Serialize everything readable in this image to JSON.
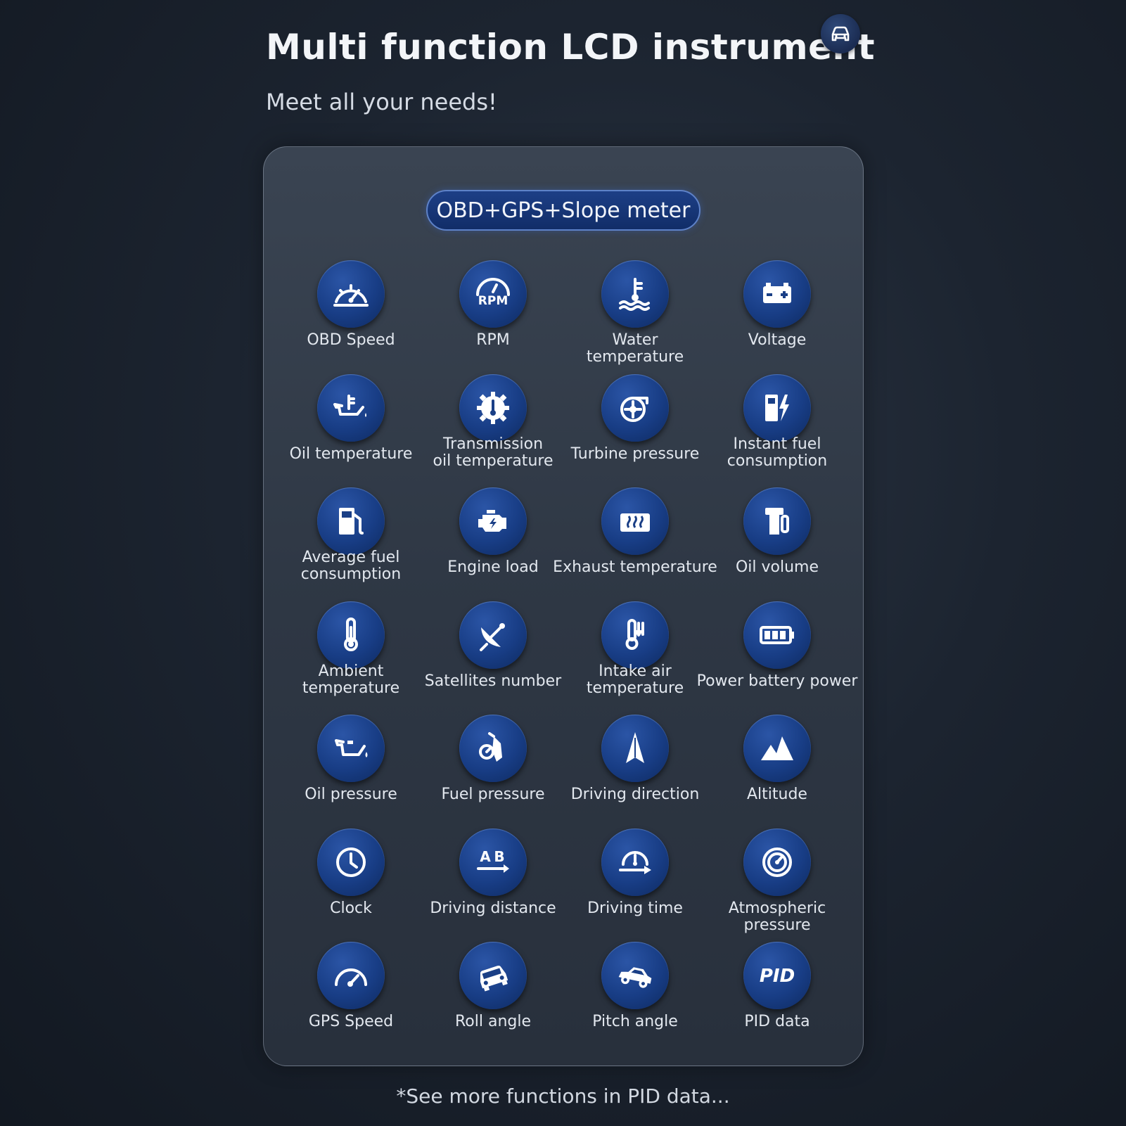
{
  "header": {
    "title": "Multi function LCD instrument",
    "subtitle": "Meet all your needs!",
    "badge_icon": "car-icon"
  },
  "panel": {
    "mode_label": "OBD+GPS+Slope meter"
  },
  "functions": [
    {
      "label": "OBD Speed",
      "icon": "speedometer-icon"
    },
    {
      "label": "RPM",
      "icon": "rpm-gauge-icon"
    },
    {
      "label": "Water temperature",
      "icon": "coolant-temperature-icon"
    },
    {
      "label": "Voltage",
      "icon": "battery-icon"
    },
    {
      "label": "Oil temperature",
      "icon": "oil-can-temperature-icon"
    },
    {
      "label": "Transmission\noil temperature",
      "icon": "gear-thermometer-icon"
    },
    {
      "label": "Turbine pressure",
      "icon": "turbo-icon"
    },
    {
      "label": "Instant fuel\nconsumption",
      "icon": "fuel-pump-lightning-icon"
    },
    {
      "label": "Average fuel\nconsumption",
      "icon": "fuel-pump-icon"
    },
    {
      "label": "Engine load",
      "icon": "engine-icon"
    },
    {
      "label": "Exhaust temperature",
      "icon": "exhaust-heat-icon"
    },
    {
      "label": "Oil volume",
      "icon": "oil-tank-icon"
    },
    {
      "label": "Ambient\ntemperature",
      "icon": "thermometer-icon"
    },
    {
      "label": "Satellites number",
      "icon": "satellite-dish-icon"
    },
    {
      "label": "Intake air\ntemperature",
      "icon": "intake-air-temperature-icon"
    },
    {
      "label": "Power battery power",
      "icon": "battery-level-icon"
    },
    {
      "label": "Oil pressure",
      "icon": "oil-can-icon"
    },
    {
      "label": "Fuel pressure",
      "icon": "fuel-nozzle-icon"
    },
    {
      "label": "Driving direction",
      "icon": "compass-arrow-icon"
    },
    {
      "label": "Altitude",
      "icon": "mountain-icon"
    },
    {
      "label": "Clock",
      "icon": "clock-icon"
    },
    {
      "label": "Driving distance",
      "icon": "distance-ab-icon"
    },
    {
      "label": "Driving time",
      "icon": "driving-time-icon"
    },
    {
      "label": "Atmospheric pressure",
      "icon": "barometer-icon"
    },
    {
      "label": "GPS Speed",
      "icon": "gps-speedometer-icon"
    },
    {
      "label": "Roll angle",
      "icon": "car-roll-icon"
    },
    {
      "label": "Pitch angle",
      "icon": "car-pitch-icon"
    },
    {
      "label": "PID data",
      "icon": "pid-icon"
    }
  ],
  "footer": {
    "note": "*See more functions in PID data..."
  }
}
